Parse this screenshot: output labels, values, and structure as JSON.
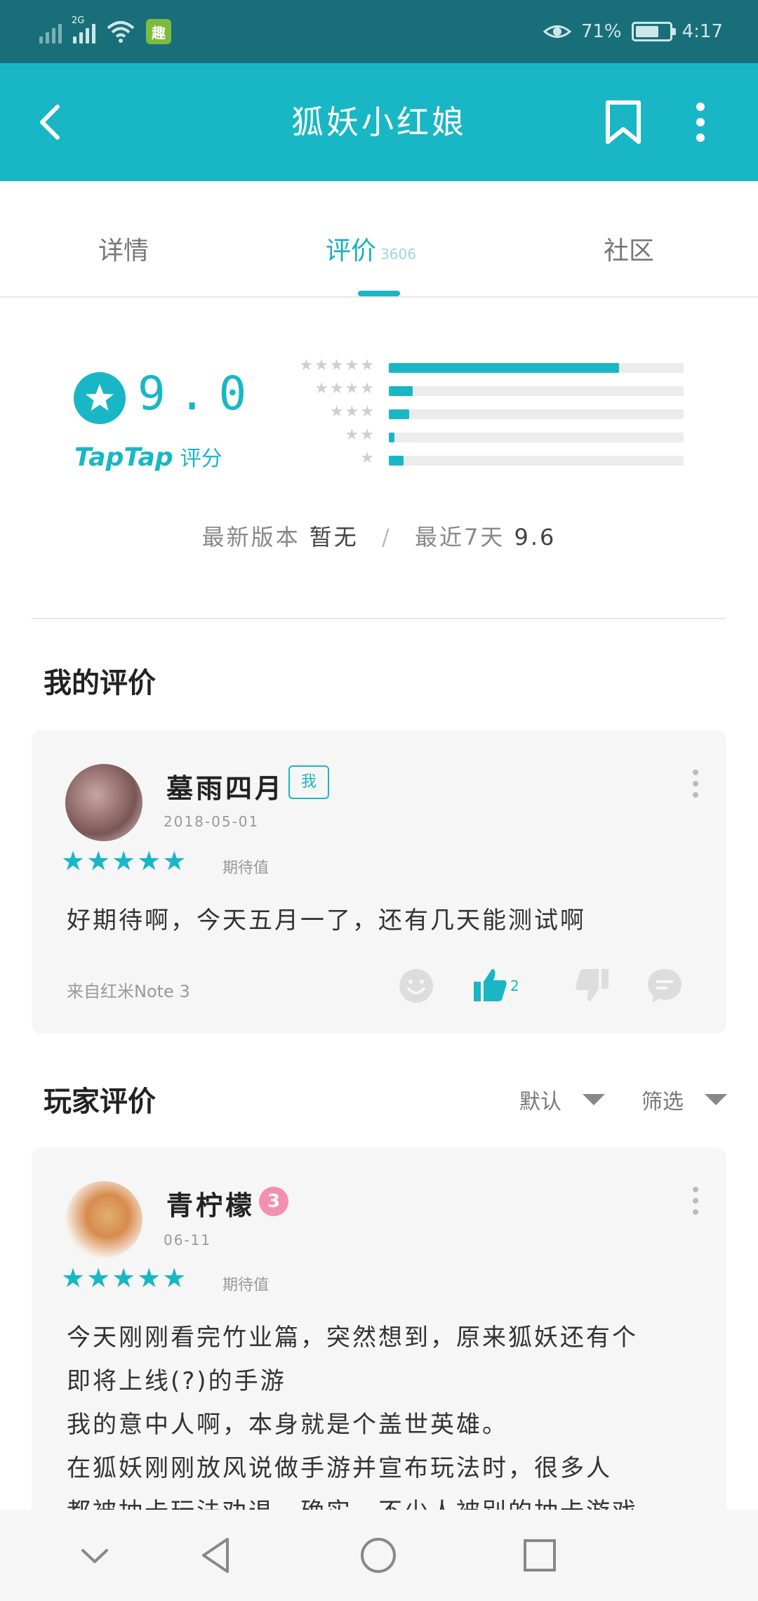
{
  "status_bar": {
    "network_label": "2G",
    "battery": "71%",
    "battery_level": 0.71,
    "time": "4:17"
  },
  "app_bar": {
    "title": "狐妖小红娘"
  },
  "tabs": [
    {
      "label": "详情"
    },
    {
      "label": "评价",
      "count": "3606"
    },
    {
      "label": "社区"
    }
  ],
  "rating": {
    "score": "9.0",
    "brand": "TapTap",
    "brand_suffix": "评分",
    "distribution": [
      {
        "stars": 5,
        "fraction": 0.78
      },
      {
        "stars": 4,
        "fraction": 0.08
      },
      {
        "stars": 3,
        "fraction": 0.07
      },
      {
        "stars": 2,
        "fraction": 0.02
      },
      {
        "stars": 1,
        "fraction": 0.05
      }
    ],
    "latest_version_label": "最新版本",
    "latest_version_value": "暂无",
    "recent_label": "最近7天",
    "recent_value": "9.6"
  },
  "my_review": {
    "section_title": "我的评价",
    "user": "墓雨四月",
    "me_tag": "我",
    "date": "2018-05-01",
    "stars_label": "期待值",
    "text": "好期待啊，今天五月一了，还有几天能测试啊",
    "device": "来自红米Note 3",
    "like_count": "2"
  },
  "player_reviews": {
    "section_title": "玩家评价",
    "sort_label": "默认",
    "filter_label": "筛选",
    "items": [
      {
        "user": "青柠檬",
        "level": "3",
        "date": "06-11",
        "stars_label": "期待值",
        "lines": [
          "今天刚刚看完竹业篇，突然想到，原来狐妖还有个",
          "即将上线(?)的手游",
          "我的意中人啊，本身就是个盖世英雄。",
          "在狐妖刚刚放风说做手游并宣布玩法时，很多人",
          "都被抽卡玩法劝退，确实，不少人被别的抽卡游戏"
        ]
      }
    ]
  },
  "colors": {
    "accent": "#19b7c5",
    "status_bar": "#186f79",
    "card_bg": "#f6f6f6"
  },
  "icons": {
    "back": "chevron-left-icon",
    "bookmark": "bookmark-icon",
    "more": "more-vertical-icon",
    "emoji": "smiley-icon",
    "like": "thumbs-up-icon",
    "dislike": "thumbs-down-icon",
    "comment": "comment-icon"
  }
}
